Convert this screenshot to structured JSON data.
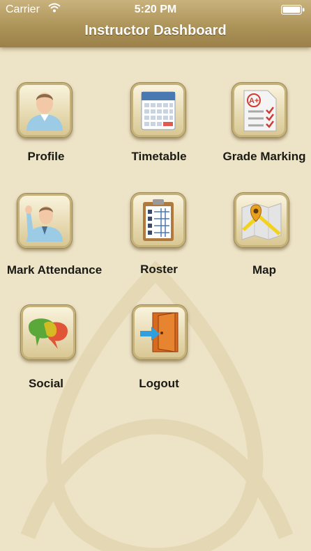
{
  "status_bar": {
    "carrier": "Carrier",
    "time": "5:20 PM"
  },
  "nav": {
    "title": "Instructor Dashboard"
  },
  "menu": [
    {
      "label": "Profile",
      "icon": "person-icon"
    },
    {
      "label": "Timetable",
      "icon": "calendar-icon"
    },
    {
      "label": "Grade Marking",
      "icon": "graded-paper-icon"
    },
    {
      "label": "Mark Attendance",
      "icon": "raised-hand-person-icon"
    },
    {
      "label": "Roster",
      "icon": "clipboard-roster-icon"
    },
    {
      "label": "Map",
      "icon": "map-pin-icon"
    },
    {
      "label": "Social",
      "icon": "speech-bubbles-icon"
    },
    {
      "label": "Logout",
      "icon": "exit-door-icon"
    }
  ],
  "colors": {
    "background": "#ede3c6",
    "nav_bar": "#aa9156",
    "tile": "#d8c690"
  }
}
